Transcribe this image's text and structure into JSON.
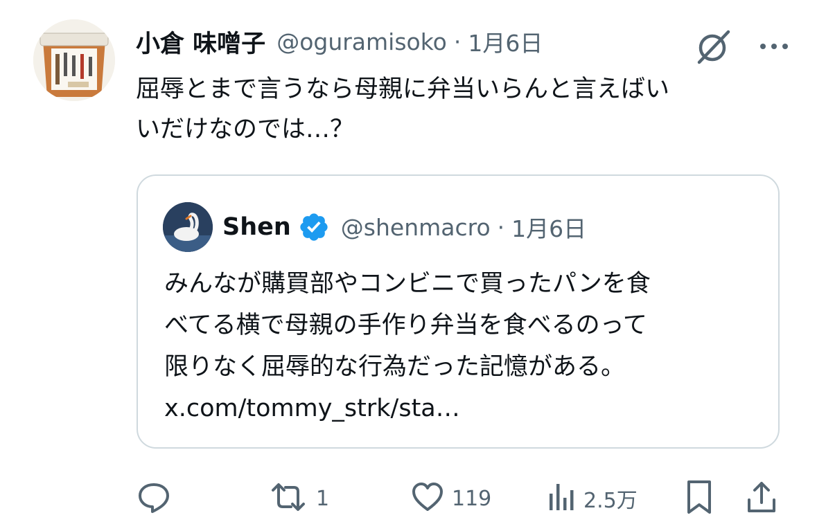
{
  "tweet": {
    "author": {
      "display_name": "小倉 味噌子",
      "handle": "@oguramisoko"
    },
    "separator": "·",
    "date": "1月6日",
    "text": "屈辱とまで言うなら母親に弁当いらんと言えばい\nいだけなのでは…？",
    "icons": {
      "grok": "grok-icon",
      "more": "more-icon"
    }
  },
  "quote": {
    "author": {
      "display_name": "Shen",
      "handle": "@shenmacro",
      "verified": true
    },
    "separator": "·",
    "date": "1月6日",
    "text": "みんなが購買部やコンビニで買ったパンを食\nべてる横で母親の手作り弁当を食べるのって\n限りなく屈辱的な行為だった記憶がある。\nx.com/tommy_strk/sta…"
  },
  "actions": {
    "reply": {
      "icon": "reply-icon",
      "count": ""
    },
    "retweet": {
      "icon": "retweet-icon",
      "count": "1"
    },
    "like": {
      "icon": "heart-icon",
      "count": "119"
    },
    "views": {
      "icon": "views-icon",
      "count": "2.5万"
    },
    "bookmark": {
      "icon": "bookmark-icon"
    },
    "share": {
      "icon": "share-icon"
    }
  },
  "colors": {
    "text_primary": "#0f1419",
    "text_secondary": "#536471",
    "border": "#cfd9de",
    "verified_blue": "#1d9bf0"
  }
}
